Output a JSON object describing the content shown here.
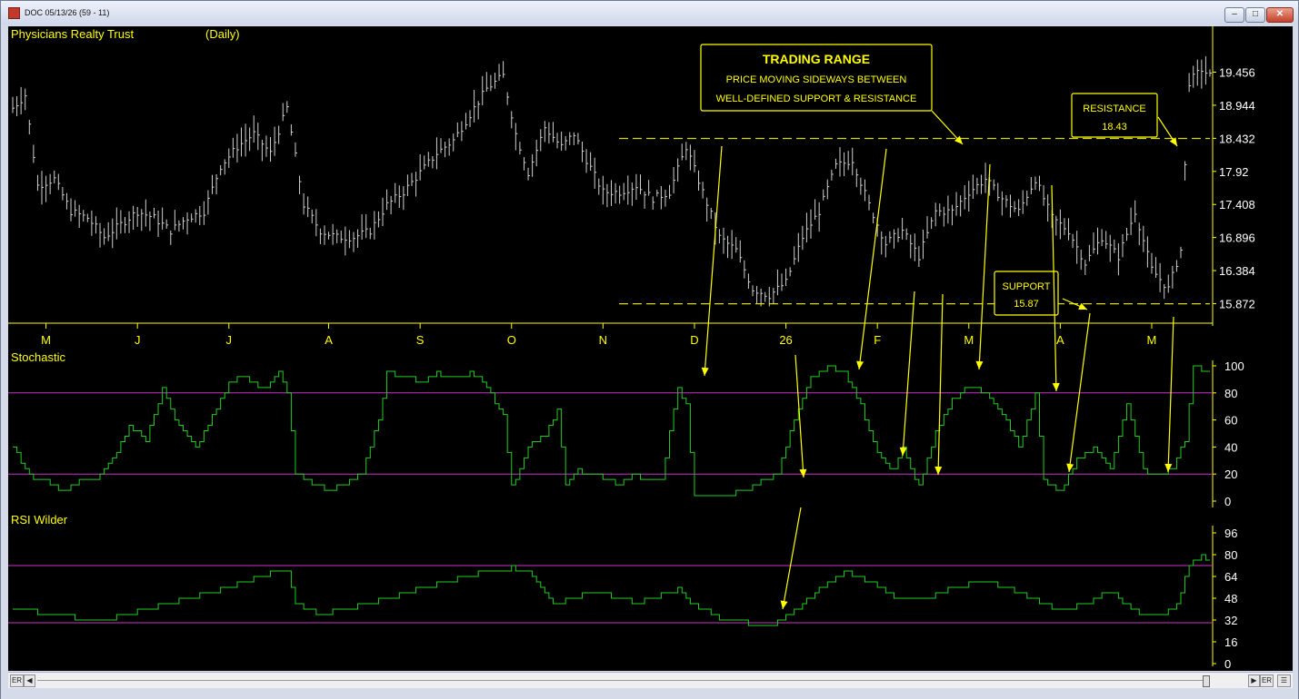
{
  "window": {
    "title": "DOC 05/13/26 (59 - 11)",
    "min_label": "‒",
    "max_label": "□",
    "close_label": "✕"
  },
  "chart": {
    "title": "Physicians Realty Trust",
    "period": "(Daily)",
    "colors": {
      "background": "#000000",
      "text": "#ffff00",
      "price_bars": "#d0d0d0",
      "indicator": "#22cc22",
      "levels": "#cc33cc",
      "annotation": "#ffff00"
    },
    "price_axis_ticks": [
      "19.456",
      "18.944",
      "18.432",
      "17.92",
      "17.408",
      "16.896",
      "16.384",
      "15.872"
    ],
    "month_labels": [
      "M",
      "J",
      "J",
      "A",
      "S",
      "O",
      "N",
      "D",
      "26",
      "F",
      "M",
      "A",
      "M"
    ],
    "stoch_title": "Stochastic",
    "stoch_ticks": [
      "100",
      "80",
      "60",
      "40",
      "20",
      "0"
    ],
    "rsi_title": "RSI Wilder",
    "rsi_ticks": [
      "96",
      "80",
      "64",
      "48",
      "32",
      "16",
      "0"
    ]
  },
  "annotations": {
    "trading_range_title": "TRADING RANGE",
    "trading_range_line1": "PRICE MOVING SIDEWAYS BETWEEN",
    "trading_range_line2": "WELL-DEFINED SUPPORT & RESISTANCE",
    "resistance_label": "RESISTANCE",
    "resistance_value": "18.43",
    "support_label": "SUPPORT",
    "support_value": "15.87"
  },
  "chart_data": {
    "type": "line",
    "title": "Physicians Realty Trust",
    "x_labels": [
      "M",
      "J",
      "J",
      "A",
      "S",
      "O",
      "N",
      "D",
      "26",
      "F",
      "M",
      "A",
      "M"
    ],
    "price": {
      "ylim": [
        15.872,
        19.456
      ],
      "resistance": 18.43,
      "support": 15.87,
      "close_points": [
        [
          0,
          18.9
        ],
        [
          3,
          19.1
        ],
        [
          6,
          17.7
        ],
        [
          10,
          17.8
        ],
        [
          14,
          17.3
        ],
        [
          18,
          17.2
        ],
        [
          22,
          16.9
        ],
        [
          26,
          17.1
        ],
        [
          30,
          17.3
        ],
        [
          34,
          17.2
        ],
        [
          38,
          17.0
        ],
        [
          42,
          17.2
        ],
        [
          46,
          17.3
        ],
        [
          50,
          18.0
        ],
        [
          54,
          18.3
        ],
        [
          58,
          18.5
        ],
        [
          62,
          18.2
        ],
        [
          66,
          18.9
        ],
        [
          70,
          17.4
        ],
        [
          74,
          17.0
        ],
        [
          78,
          16.9
        ],
        [
          82,
          16.9
        ],
        [
          86,
          17.0
        ],
        [
          90,
          17.4
        ],
        [
          94,
          17.6
        ],
        [
          98,
          17.9
        ],
        [
          102,
          18.2
        ],
        [
          106,
          18.4
        ],
        [
          110,
          18.8
        ],
        [
          114,
          19.2
        ],
        [
          118,
          19.4
        ],
        [
          121,
          18.5
        ],
        [
          124,
          17.9
        ],
        [
          128,
          18.6
        ],
        [
          132,
          18.3
        ],
        [
          135,
          18.5
        ],
        [
          138,
          18.1
        ],
        [
          142,
          17.6
        ],
        [
          146,
          17.6
        ],
        [
          150,
          17.7
        ],
        [
          154,
          17.5
        ],
        [
          158,
          17.6
        ],
        [
          162,
          18.3
        ],
        [
          166,
          17.6
        ],
        [
          170,
          16.9
        ],
        [
          174,
          16.7
        ],
        [
          178,
          16.1
        ],
        [
          182,
          16.0
        ],
        [
          186,
          16.2
        ],
        [
          190,
          16.9
        ],
        [
          194,
          17.3
        ],
        [
          198,
          18.0
        ],
        [
          202,
          18.1
        ],
        [
          206,
          17.4
        ],
        [
          210,
          16.8
        ],
        [
          214,
          17.0
        ],
        [
          218,
          16.6
        ],
        [
          222,
          17.3
        ],
        [
          226,
          17.3
        ],
        [
          230,
          17.6
        ],
        [
          234,
          17.8
        ],
        [
          238,
          17.5
        ],
        [
          242,
          17.3
        ],
        [
          246,
          17.8
        ],
        [
          250,
          17.2
        ],
        [
          254,
          17.0
        ],
        [
          258,
          16.5
        ],
        [
          262,
          16.9
        ],
        [
          266,
          16.6
        ],
        [
          270,
          17.3
        ],
        [
          274,
          16.4
        ],
        [
          278,
          16.1
        ],
        [
          281,
          16.7
        ],
        [
          283,
          19.3
        ],
        [
          286,
          19.5
        ],
        [
          288,
          19.4
        ]
      ]
    },
    "stochastic": {
      "ylim": [
        0,
        100
      ],
      "levels": [
        80,
        20
      ],
      "points": [
        [
          0,
          40
        ],
        [
          4,
          18
        ],
        [
          8,
          15
        ],
        [
          12,
          8
        ],
        [
          16,
          14
        ],
        [
          20,
          15
        ],
        [
          24,
          30
        ],
        [
          28,
          55
        ],
        [
          32,
          45
        ],
        [
          36,
          82
        ],
        [
          40,
          55
        ],
        [
          44,
          38
        ],
        [
          48,
          62
        ],
        [
          52,
          88
        ],
        [
          56,
          92
        ],
        [
          60,
          82
        ],
        [
          64,
          97
        ],
        [
          66,
          80
        ],
        [
          68,
          20
        ],
        [
          72,
          12
        ],
        [
          76,
          8
        ],
        [
          80,
          12
        ],
        [
          84,
          20
        ],
        [
          88,
          60
        ],
        [
          90,
          95
        ],
        [
          94,
          92
        ],
        [
          98,
          88
        ],
        [
          102,
          94
        ],
        [
          106,
          90
        ],
        [
          110,
          95
        ],
        [
          114,
          85
        ],
        [
          118,
          62
        ],
        [
          120,
          10
        ],
        [
          124,
          40
        ],
        [
          128,
          48
        ],
        [
          131,
          68
        ],
        [
          133,
          12
        ],
        [
          136,
          22
        ],
        [
          140,
          20
        ],
        [
          142,
          16
        ],
        [
          146,
          12
        ],
        [
          150,
          20
        ],
        [
          152,
          15
        ],
        [
          156,
          15
        ],
        [
          160,
          85
        ],
        [
          162,
          70
        ],
        [
          164,
          5
        ],
        [
          168,
          2
        ],
        [
          172,
          5
        ],
        [
          176,
          8
        ],
        [
          180,
          15
        ],
        [
          184,
          20
        ],
        [
          188,
          60
        ],
        [
          192,
          90
        ],
        [
          196,
          100
        ],
        [
          200,
          95
        ],
        [
          204,
          70
        ],
        [
          208,
          35
        ],
        [
          212,
          22
        ],
        [
          214,
          38
        ],
        [
          216,
          22
        ],
        [
          218,
          10
        ],
        [
          222,
          50
        ],
        [
          226,
          75
        ],
        [
          230,
          85
        ],
        [
          234,
          80
        ],
        [
          238,
          65
        ],
        [
          242,
          40
        ],
        [
          246,
          78
        ],
        [
          248,
          15
        ],
        [
          252,
          8
        ],
        [
          256,
          30
        ],
        [
          260,
          40
        ],
        [
          264,
          25
        ],
        [
          268,
          72
        ],
        [
          272,
          22
        ],
        [
          276,
          18
        ],
        [
          279,
          25
        ],
        [
          282,
          45
        ],
        [
          284,
          100
        ],
        [
          288,
          95
        ]
      ]
    },
    "rsi": {
      "ylim": [
        0,
        96
      ],
      "levels": [
        72,
        30
      ],
      "points": [
        [
          0,
          40
        ],
        [
          10,
          36
        ],
        [
          20,
          31
        ],
        [
          30,
          38
        ],
        [
          40,
          46
        ],
        [
          50,
          54
        ],
        [
          60,
          65
        ],
        [
          66,
          69
        ],
        [
          68,
          44
        ],
        [
          74,
          36
        ],
        [
          80,
          40
        ],
        [
          90,
          48
        ],
        [
          100,
          57
        ],
        [
          110,
          65
        ],
        [
          120,
          70
        ],
        [
          124,
          66
        ],
        [
          130,
          43
        ],
        [
          140,
          53
        ],
        [
          150,
          45
        ],
        [
          160,
          54
        ],
        [
          164,
          43
        ],
        [
          170,
          33
        ],
        [
          176,
          30
        ],
        [
          182,
          26
        ],
        [
          188,
          38
        ],
        [
          194,
          54
        ],
        [
          200,
          68
        ],
        [
          206,
          60
        ],
        [
          212,
          48
        ],
        [
          218,
          46
        ],
        [
          226,
          56
        ],
        [
          234,
          60
        ],
        [
          240,
          54
        ],
        [
          246,
          46
        ],
        [
          252,
          38
        ],
        [
          258,
          44
        ],
        [
          264,
          53
        ],
        [
          270,
          38
        ],
        [
          276,
          36
        ],
        [
          280,
          42
        ],
        [
          283,
          72
        ],
        [
          286,
          78
        ],
        [
          288,
          75
        ]
      ]
    }
  }
}
